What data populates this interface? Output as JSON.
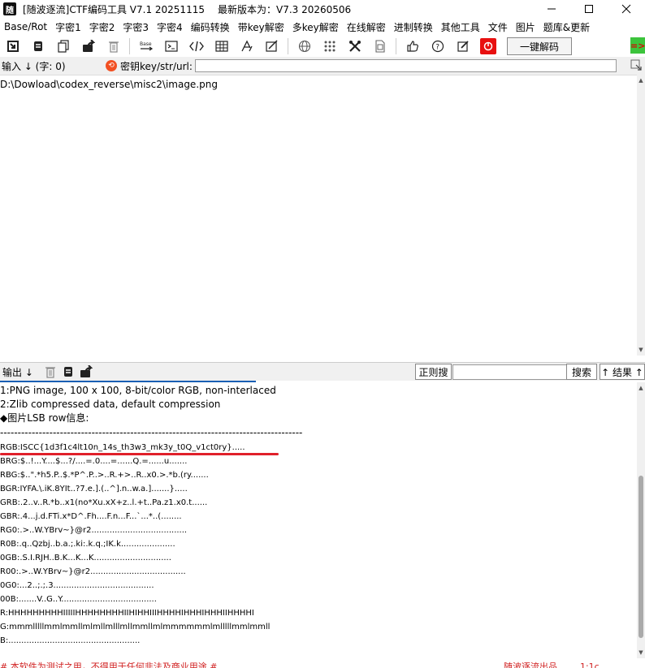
{
  "window": {
    "title": "[随波逐流]CTF编码工具 V7.1 20251115",
    "latest_version": "最新版本为：V7.3  20260506",
    "app_icon_text": "随"
  },
  "menu": [
    "Base/Rot",
    "字密1",
    "字密2",
    "字密3",
    "字密4",
    "编码转换",
    "带key解密",
    "多key解密",
    "在线解密",
    "进制转换",
    "其他工具",
    "文件",
    "图片",
    "题库&更新"
  ],
  "toolbar": {
    "decode_label": "一键解码",
    "arrow_text": "=>"
  },
  "input_bar": {
    "label": "输入 ↓ (字: 0)",
    "key_label": "密钥key/str/url:",
    "key_value": ""
  },
  "input": {
    "text": "D:\\Dowload\\codex_reverse\\misc2\\image.png"
  },
  "output_bar": {
    "label": "输出 ↓",
    "regex_label": "正则搜",
    "search_value": "",
    "search_label": "搜索",
    "result_label": "↑ 结果 ↑"
  },
  "output": {
    "lines": [
      "1:PNG image, 100 x 100, 8-bit/color RGB, non-interlaced",
      "2:Zlib compressed data, default compression",
      "◆图片LSB row信息:",
      "--------------------------------------------------------------------------------------",
      "RGB:ISCC{1d3f1c4lt10n_14s_th3w3_mk3y_t0Q_v1ct0ry}.....",
      "BRG:$..!...Y....$...?/....=.0....=......Q.=......u.......",
      "RBG:$..\".*h5.P..$.*P^.P..>..R.+>..R..x0.>.*b.(ry.......",
      "BGR:IYFA.\\.iK.8YIt..?7.e.].(..^].n..w.a.].......}.....",
      "GRB:.2..v..R.*b..x1(no*Xu.xX+z..l.+t..Pa.z1.x0.t......",
      "GBR:.4...j.d.FTi.x*D^.Fh....F.n...F...`...*..(........",
      "RG0:.>..W.YBrv~}@r2.....................................",
      "R0B:.q..Qzbj..b.a.;.ki:.k.q.;IK.k.....................",
      "0GB:.S.I.RJH..B.K...K...K..............................",
      "R00:.>..W.YBrv~}@r2.....................................",
      "0G0:...2..;.;.3.......................................",
      "00B:.......V..G..Y.....................................",
      "R:HHHHHHHHHIIIIIHHHHHHHHIIHIHHIIIHHHHIHHHIHHHIIHHHHI",
      "G:mmmlllllmmlmmllmlmllmlllmllmmllmlmmmmmmlmlllllmmlmmll",
      "B:..................................................."
    ]
  },
  "footer": {
    "left": "# 本软件为测试之用，不得用于任何非法及商业用途 #",
    "right": "随波逐流出品 ...... 1:1c"
  }
}
